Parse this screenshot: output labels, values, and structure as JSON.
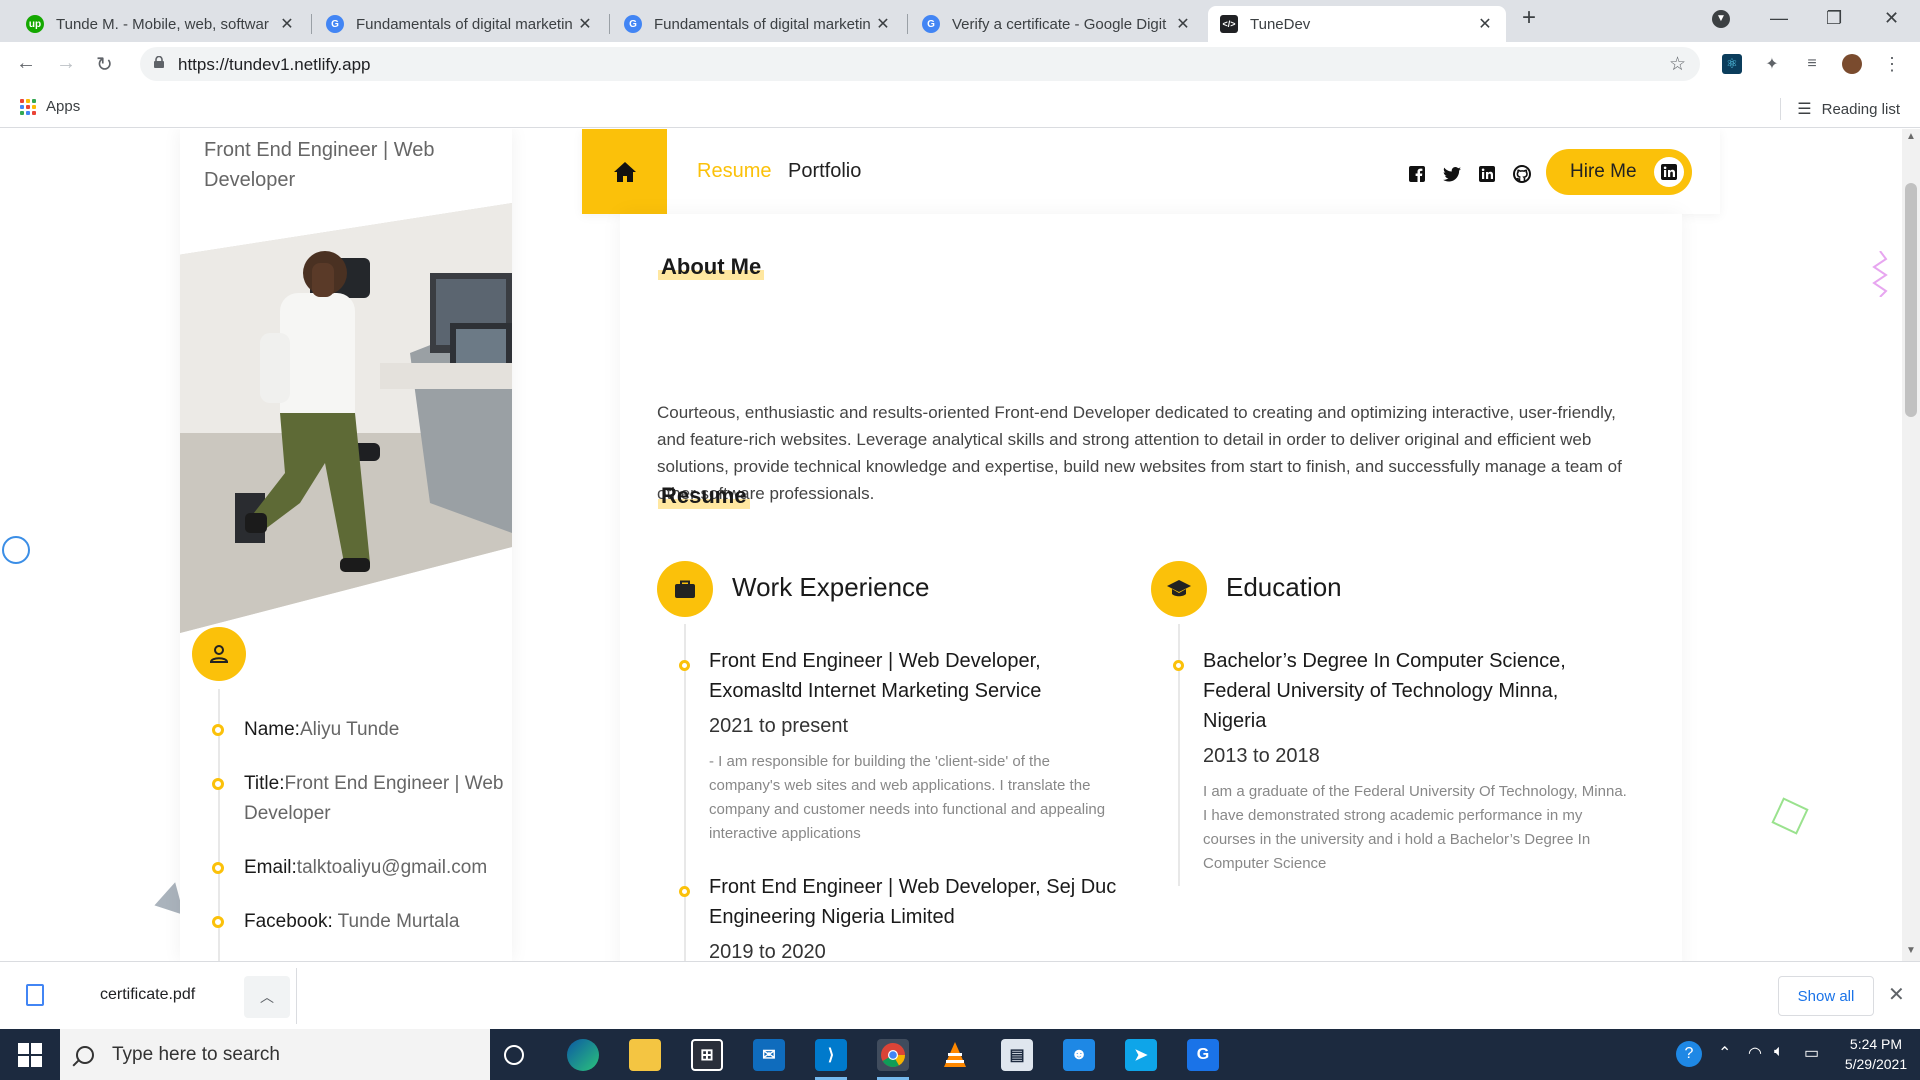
{
  "browser": {
    "tabs": [
      {
        "label": "Tunde M. - Mobile, web, softwar",
        "icon": "upwork-icon",
        "color": "#14a800"
      },
      {
        "label": "Fundamentals of digital marketin",
        "icon": "google-icon",
        "color": "#4285f4"
      },
      {
        "label": "Fundamentals of digital marketin",
        "icon": "google-icon",
        "color": "#4285f4"
      },
      {
        "label": "Verify a certificate - Google Digit",
        "icon": "google-icon",
        "color": "#4285f4"
      },
      {
        "label": "TuneDev",
        "icon": "code-icon",
        "color": "#202124"
      }
    ],
    "url": "https://tundev1.netlify.app",
    "bookmarks": {
      "apps_label": "Apps",
      "reading_list_label": "Reading list"
    }
  },
  "profile": {
    "subtitle": "Front End Engineer | Web Developer",
    "info": [
      {
        "key": "Name:",
        "value": "Aliyu Tunde"
      },
      {
        "key": "Title:",
        "value": "Front End Engineer | Web Developer"
      },
      {
        "key": "Email:",
        "value": "talktoaliyu@gmail.com"
      },
      {
        "key": "Facebook: ",
        "value": "Tunde Murtala"
      }
    ]
  },
  "nav": {
    "links": [
      "Resume",
      "Portfolio"
    ],
    "social_icons": [
      "facebook-icon",
      "twitter-icon",
      "linkedin-icon",
      "github-icon"
    ],
    "hire_label": "Hire Me",
    "accent": "#fbc10a"
  },
  "about": {
    "title": "About Me",
    "text": "Courteous, enthusiastic and results-oriented Front-end Developer dedicated to creating and optimizing interactive, user-friendly, and feature-rich websites. Leverage analytical skills and strong attention to detail in order to deliver original and efficient web solutions, provide technical knowledge and expertise, build new websites from start to finish, and successfully manage a team of other software professionals."
  },
  "resume": {
    "title": "Resume",
    "work": {
      "title": "Work Experience",
      "items": [
        {
          "title": "Front End Engineer | Web Developer, Exomasltd Internet Marketing Service",
          "date": "2021 to present",
          "desc": "- I am responsible for building the 'client-side' of the company's web sites and web applications. I translate the company and customer needs into functional and appealing interactive applications"
        },
        {
          "title": "Front End Engineer | Web Developer, Sej Duc Engineering Nigeria Limited",
          "date": "2019 to 2020",
          "desc": ""
        }
      ]
    },
    "education": {
      "title": "Education",
      "items": [
        {
          "title": "Bachelor’s Degree In Computer Science, Federal University of Technology Minna, Nigeria",
          "date": "2013 to 2018",
          "desc": "I am a graduate of the Federal University Of Technology, Minna. I have demonstrated strong academic performance in my courses in the university and i hold a Bachelor’s Degree In Computer Science"
        }
      ]
    }
  },
  "downloads": {
    "file": "certificate.pdf",
    "show_all": "Show all"
  },
  "taskbar": {
    "search_placeholder": "Type here to search",
    "time": "5:24 PM",
    "date": "5/29/2021",
    "apps": [
      "edge-icon",
      "file-explorer-icon",
      "store-icon",
      "mail-icon",
      "vscode-icon",
      "chrome-icon",
      "vlc-icon",
      "app-icon",
      "people-icon",
      "send-icon",
      "pdf-icon"
    ]
  }
}
